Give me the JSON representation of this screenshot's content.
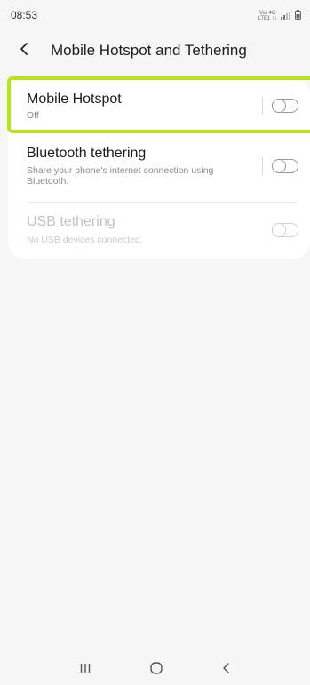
{
  "status_bar": {
    "time": "08:53",
    "network_line1": "Vo) 4G",
    "network_line2": "LTE1 ↑↓"
  },
  "header": {
    "title": "Mobile Hotspot and Tethering",
    "back_icon": "chevron-left-icon"
  },
  "settings": [
    {
      "title": "Mobile Hotspot",
      "subtitle": "Off",
      "enabled": true,
      "toggle_on": false
    },
    {
      "title": "Bluetooth tethering",
      "subtitle": "Share your phone's internet connection using Bluetooth.",
      "enabled": true,
      "toggle_on": false
    },
    {
      "title": "USB tethering",
      "subtitle": "No USB devices connected.",
      "enabled": false,
      "toggle_on": false
    }
  ],
  "nav_bar": {
    "recents_icon": "recents-icon",
    "home_icon": "home-icon",
    "back_icon": "back-icon"
  },
  "colors": {
    "background": "#f6f6f6",
    "card": "#ffffff",
    "highlight": "#b6e619",
    "toggle_off": "#9a9a9a",
    "disabled_text": "#c3c3c3"
  }
}
